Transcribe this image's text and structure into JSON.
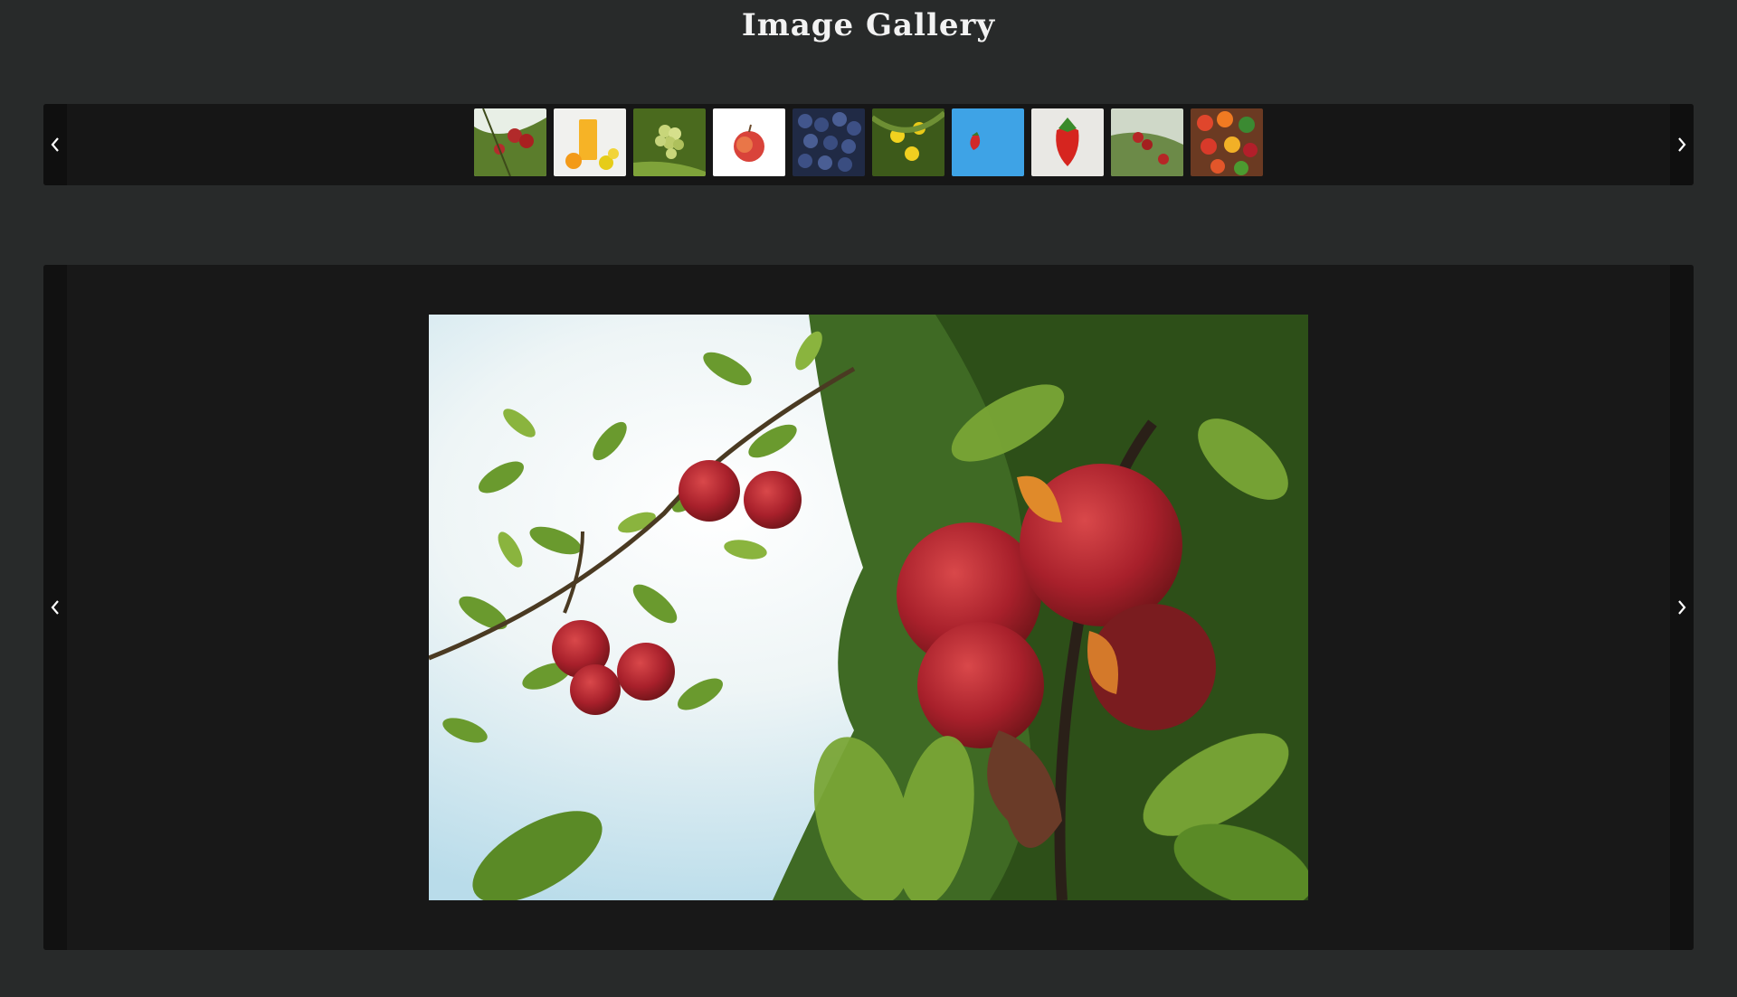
{
  "page": {
    "title": "Image Gallery"
  },
  "thumbnails": [
    {
      "icon": "apple-tree-thumbnail"
    },
    {
      "icon": "lemonade-thumbnail"
    },
    {
      "icon": "grapes-thumbnail"
    },
    {
      "icon": "apple-thumbnail"
    },
    {
      "icon": "blueberries-thumbnail"
    },
    {
      "icon": "lemon-tree-thumbnail"
    },
    {
      "icon": "strawberry-blue-thumbnail"
    },
    {
      "icon": "strawberry-thumbnail"
    },
    {
      "icon": "apple-branch-thumbnail"
    },
    {
      "icon": "mixed-fruit-thumbnail"
    }
  ],
  "viewer": {
    "selected_index": 0,
    "image_icon": "apple-tree-photo"
  },
  "colors": {
    "background": "#282a2a",
    "panel": "#181818",
    "nav": "#111111",
    "title": "#f2f2f2"
  }
}
